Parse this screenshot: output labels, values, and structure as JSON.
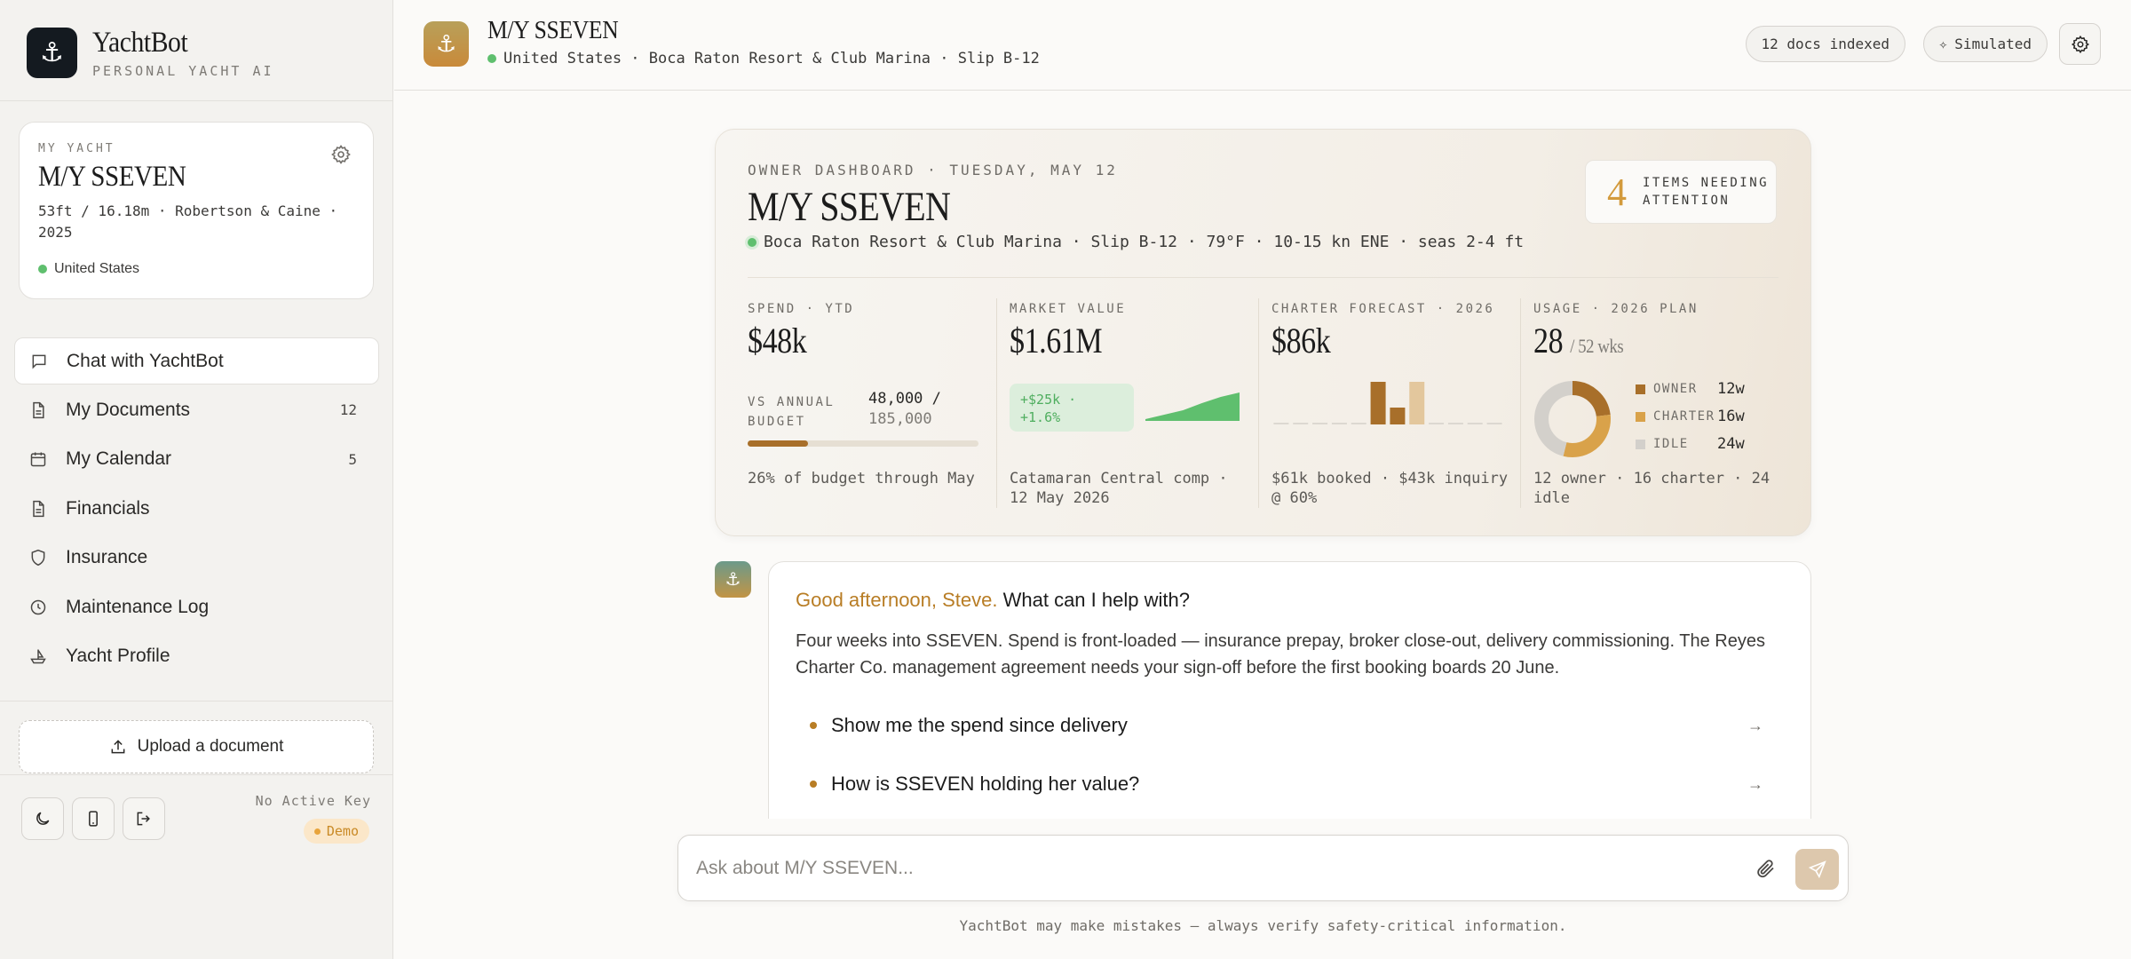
{
  "brand": {
    "name": "YachtBot",
    "tagline": "PERSONAL YACHT AI"
  },
  "yacht_card": {
    "label": "MY YACHT",
    "name": "M/Y SSEVEN",
    "spec": "53ft / 16.18m · Robertson & Caine · 2025",
    "location": "United States"
  },
  "nav": [
    {
      "label": "Chat with YachtBot",
      "icon": "chat-icon",
      "count": ""
    },
    {
      "label": "My Documents",
      "icon": "document-icon",
      "count": "12"
    },
    {
      "label": "My Calendar",
      "icon": "calendar-icon",
      "count": "5"
    },
    {
      "label": "Financials",
      "icon": "document-icon",
      "count": ""
    },
    {
      "label": "Insurance",
      "icon": "shield-icon",
      "count": ""
    },
    {
      "label": "Maintenance Log",
      "icon": "clock-icon",
      "count": ""
    },
    {
      "label": "Yacht Profile",
      "icon": "ship-icon",
      "count": ""
    }
  ],
  "upload": {
    "label": "Upload a document"
  },
  "footer": {
    "key_label": "No Active Key",
    "demo_label": "Demo"
  },
  "header": {
    "title": "M/Y SSEVEN",
    "subtitle": "United States · Boca Raton Resort & Club Marina · Slip B-12",
    "docs_pill": "12 docs indexed",
    "mode_pill": "Simulated"
  },
  "dashboard": {
    "overline": "OWNER DASHBOARD · TUESDAY, MAY 12",
    "name": "M/Y SSEVEN",
    "conditions": "Boca Raton Resort & Club Marina · Slip B-12 · 79°F · 10-15 kn ENE · seas 2-4 ft",
    "attention": {
      "count": "4",
      "line1": "ITEMS NEEDING",
      "line2": "ATTENTION"
    },
    "spend": {
      "label": "SPEND · YTD",
      "value": "$48k",
      "budget_label_1": "VS ANNUAL",
      "budget_label_2": "BUDGET",
      "budget_used": "48,000 /",
      "budget_total": "185,000",
      "budget_fraction": 0.26,
      "footer": "26% of budget through May"
    },
    "market": {
      "label": "MARKET VALUE",
      "value": "$1.61M",
      "delta_1": "+$25k ·",
      "delta_2": "+1.6%",
      "trend": [
        1.58,
        1.585,
        1.59,
        1.598,
        1.605,
        1.61
      ],
      "footer_1": "Catamaran Central comp ·",
      "footer_2": "12 May 2026"
    },
    "charter": {
      "label": "CHARTER FORECAST · 2026",
      "value": "$86k",
      "bars": [
        {
          "value": 0,
          "status": "none"
        },
        {
          "value": 0,
          "status": "none"
        },
        {
          "value": 0,
          "status": "none"
        },
        {
          "value": 0,
          "status": "none"
        },
        {
          "value": 0,
          "status": "none"
        },
        {
          "value": 48,
          "status": "booked"
        },
        {
          "value": 19,
          "status": "booked"
        },
        {
          "value": 48,
          "status": "inquiry"
        },
        {
          "value": 0,
          "status": "none"
        },
        {
          "value": 0,
          "status": "none"
        },
        {
          "value": 0,
          "status": "none"
        },
        {
          "value": 0,
          "status": "none"
        }
      ],
      "footer_1": "$61k booked · $43k inquiry",
      "footer_2": "@ 60%"
    },
    "usage": {
      "label": "USAGE · 2026 PLAN",
      "value": "28",
      "value_suffix": "/ 52 wks",
      "segments": [
        {
          "name": "OWNER",
          "weeks": 12,
          "display": "12w",
          "color": "#a86f2a"
        },
        {
          "name": "CHARTER",
          "weeks": 16,
          "display": "16w",
          "color": "#d9a24a"
        },
        {
          "name": "IDLE",
          "weeks": 24,
          "display": "24w",
          "color": "#d3d0cb"
        }
      ],
      "footer_1": "12 owner · 16 charter · 24",
      "footer_2": "idle"
    }
  },
  "chat": {
    "greeting_name": "Good afternoon, Steve.",
    "greeting_rest": " What can I help with?",
    "body": "Four weeks into SSEVEN. Spend is front-loaded — insurance prepay, broker close-out, delivery commissioning. The Reyes Charter Co. management agreement needs your sign-off before the first booking boards 20 June.",
    "suggestions": [
      "Show me the spend since delivery",
      "How is SSEVEN holding her value?"
    ]
  },
  "composer": {
    "placeholder": "Ask about M/Y SSEVEN..."
  },
  "disclaimer": "YachtBot may make mistakes — always verify safety-critical information.",
  "colors": {
    "accent": "#b87d25",
    "green": "#5fbf6e",
    "dark": "#141a20"
  }
}
